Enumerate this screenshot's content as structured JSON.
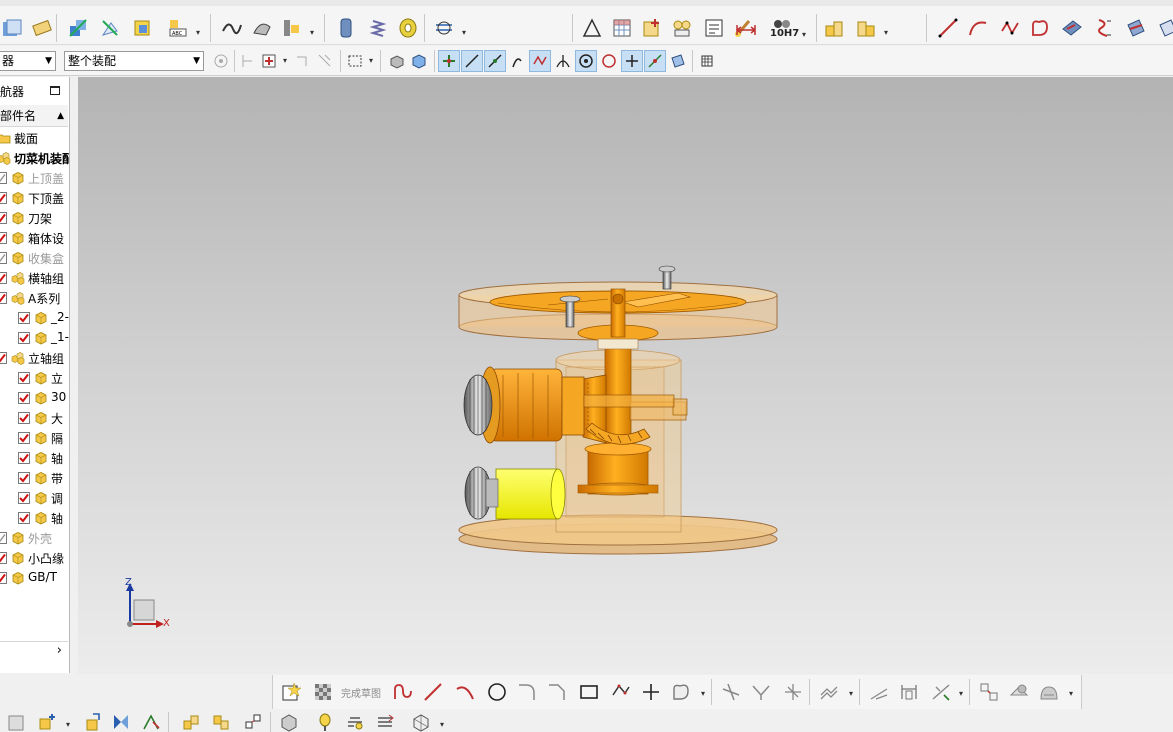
{
  "toolbar_main": {
    "fit_label": "10H7",
    "icons": [
      "route-icon",
      "chart-icon",
      "assembly-icon",
      "assembly-icon",
      "text-icon",
      "curve-icon",
      "shape-icon",
      "text-icon",
      "pipe-icon",
      "spring-icon",
      "bearing-icon",
      "wire-icon",
      "triangle-icon",
      "table-icon",
      "assembly-icon",
      "assembly-icon",
      "edit-icon",
      "brush-icon",
      "dimension-icon",
      "assembly-icon",
      "assembly-icon",
      "line-icon",
      "arc-icon",
      "spline-icon",
      "shape-icon",
      "plane-icon",
      "surface-icon",
      "surface-icon"
    ]
  },
  "toolbar_selection": {
    "filter_value": "器",
    "scope_value": "整个装配"
  },
  "navigator": {
    "title": "航器",
    "column_header": "部件名",
    "items": [
      {
        "label": "截面",
        "checked": null,
        "style": "normal",
        "icon": "folder-icon"
      },
      {
        "label": "切菜机装配",
        "checked": null,
        "style": "bold",
        "icon": "assembly-icon"
      },
      {
        "label": "上顶盖",
        "checked": false,
        "style": "grey",
        "icon": "part-icon"
      },
      {
        "label": "下顶盖",
        "checked": true,
        "style": "normal",
        "icon": "part-icon"
      },
      {
        "label": "刀架",
        "checked": true,
        "style": "normal",
        "icon": "part-icon"
      },
      {
        "label": "箱体设",
        "checked": true,
        "style": "normal",
        "icon": "part-icon"
      },
      {
        "label": "收集盒",
        "checked": false,
        "style": "grey",
        "icon": "part-icon"
      },
      {
        "label": "横轴组",
        "checked": true,
        "style": "normal",
        "icon": "assembly-icon"
      },
      {
        "label": "A系列",
        "checked": true,
        "style": "normal",
        "icon": "assembly-icon"
      },
      {
        "label": "_2-",
        "checked": true,
        "style": "normal",
        "icon": "part-icon"
      },
      {
        "label": "_1-",
        "checked": true,
        "style": "normal",
        "icon": "part-icon"
      },
      {
        "label": "立轴组",
        "checked": true,
        "style": "normal",
        "icon": "assembly-icon"
      },
      {
        "label": "立",
        "checked": true,
        "style": "normal",
        "icon": "part-icon"
      },
      {
        "label": "30",
        "checked": true,
        "style": "normal",
        "icon": "part-icon"
      },
      {
        "label": "大",
        "checked": true,
        "style": "normal",
        "icon": "part-icon"
      },
      {
        "label": "隔",
        "checked": true,
        "style": "normal",
        "icon": "part-icon"
      },
      {
        "label": "轴",
        "checked": true,
        "style": "normal",
        "icon": "part-icon"
      },
      {
        "label": "带",
        "checked": true,
        "style": "normal",
        "icon": "part-icon"
      },
      {
        "label": "调",
        "checked": true,
        "style": "normal",
        "icon": "part-icon"
      },
      {
        "label": "轴",
        "checked": true,
        "style": "normal",
        "icon": "part-icon"
      },
      {
        "label": "外壳",
        "checked": false,
        "style": "grey",
        "icon": "part-icon"
      },
      {
        "label": "小凸缘",
        "checked": true,
        "style": "normal",
        "icon": "part-icon"
      },
      {
        "label": "GB/T",
        "checked": true,
        "style": "normal",
        "icon": "part-icon"
      }
    ],
    "scroll_arrow": "›"
  },
  "viewport": {
    "triad": {
      "z_label": "Z",
      "x_label": "X"
    },
    "colors": {
      "body": "#f5a623",
      "body_dark": "#d07800",
      "translucent": "#e8b870",
      "motor": "#ffff00"
    }
  },
  "sketch_toolbar": {
    "finish_label": "完成草图",
    "icons": [
      "sketch-icon",
      "finish-sketch-icon",
      "profile-icon",
      "line-icon",
      "arc-icon",
      "circle-icon",
      "fillet-icon",
      "chamfer-icon",
      "rectangle-icon",
      "polygon-icon",
      "point-icon",
      "shape-icon",
      "trim-icon",
      "extend-icon",
      "corner-icon",
      "offset-icon",
      "mirror-icon",
      "dimension-icon",
      "constraint-icon",
      "constraint-icon",
      "display-icon",
      "display-icon"
    ]
  },
  "assembly_toolbar": {
    "icons": [
      "assembly-icon",
      "add-component-icon",
      "move-icon",
      "mirror-icon",
      "constraint-icon",
      "assembly-icon",
      "assembly-icon",
      "explode-icon",
      "section-icon",
      "clearance-icon",
      "wave-icon",
      "component-icon"
    ]
  }
}
